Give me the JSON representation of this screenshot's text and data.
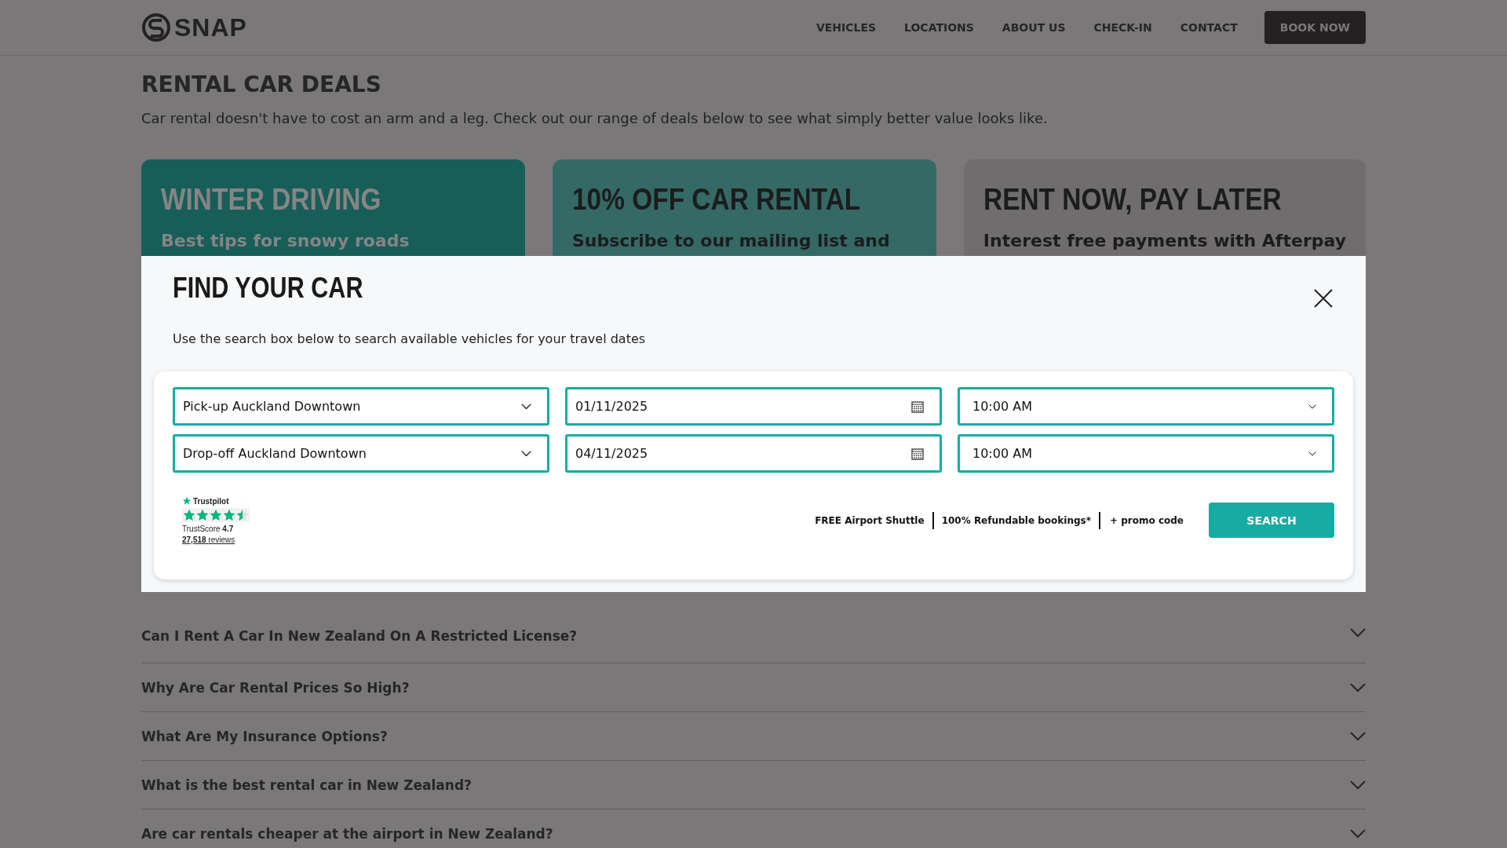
{
  "header": {
    "logo": "SNAP",
    "nav": [
      "VEHICLES",
      "LOCATIONS",
      "ABOUT US",
      "CHECK-IN",
      "CONTACT"
    ],
    "cta": "BOOK NOW"
  },
  "intro": {
    "title": "RENTAL CAR DEALS",
    "text": "Car rental doesn't have to cost an arm and a leg. Check out our range of deals below to see what simply better value looks like."
  },
  "deals": [
    {
      "title": "WINTER DRIVING",
      "subtitle": "Best tips for snowy roads",
      "color": "#175e59"
    },
    {
      "title": "10% OFF CAR RENTAL",
      "subtitle": "Subscribe to our mailing list and",
      "color": "#356966"
    },
    {
      "title": "RENT NOW, PAY LATER",
      "subtitle": "Interest free payments with Afterpay",
      "color": "#6f6d6e"
    }
  ],
  "modal": {
    "title": "FIND YOUR CAR",
    "subtitle": "Use the search box below to search available vehicles for your travel dates",
    "fields": [
      {
        "kind": "select",
        "value": "Pick-up Auckland Downtown"
      },
      {
        "kind": "date",
        "value": "01/11/2025"
      },
      {
        "kind": "time",
        "value": "10:00 AM"
      },
      {
        "kind": "select",
        "value": "Drop-off Auckland Downtown"
      },
      {
        "kind": "date",
        "value": "04/11/2025"
      },
      {
        "kind": "time",
        "value": "10:00 AM"
      }
    ],
    "trustpilot": {
      "brand": "Trustpilot",
      "stars": 4.5,
      "score_label": "TrustScore",
      "score": "4.7",
      "reviews": "27,518",
      "reviews_label": "reviews"
    },
    "perks": [
      "FREE Airport Shuttle",
      "100% Refundable bookings*"
    ],
    "promo": "+ promo code",
    "search": "SEARCH"
  },
  "faq": [
    "Can I Rent A Car In New Zealand On A Restricted License?",
    "Why Are Car Rental Prices So High?",
    "What Are My Insurance Options?",
    "What is the best rental car in New Zealand?",
    "Are car rentals cheaper at the airport in New Zealand?"
  ]
}
